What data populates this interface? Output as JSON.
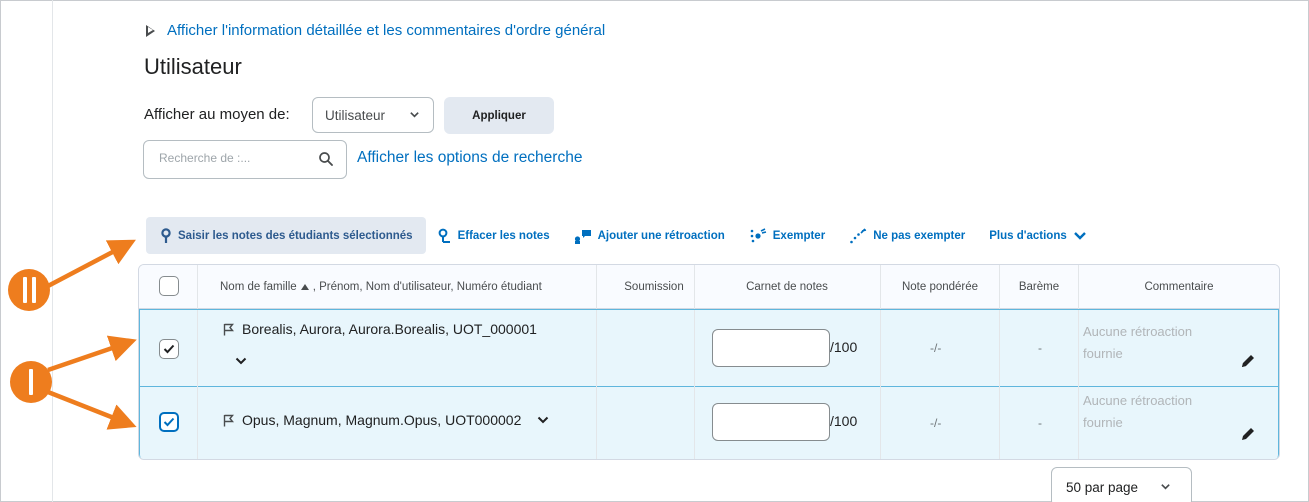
{
  "details_link": "Afficher l'information détaillée et les commentaires d'ordre général",
  "page_title": "Utilisateur",
  "view_by": {
    "label": "Afficher au moyen de:",
    "selected": "Utilisateur",
    "apply_label": "Appliquer"
  },
  "search": {
    "placeholder": "Recherche de :...",
    "options_link": "Afficher les options de recherche"
  },
  "toolbar": {
    "enter_grades": "Saisir les notes des étudiants sélectionnés",
    "clear_grades": "Effacer les notes",
    "add_feedback": "Ajouter une rétroaction",
    "exempt": "Exempter",
    "unexempt": "Ne pas exempter",
    "more_actions": "Plus d'actions"
  },
  "table": {
    "headers": {
      "name": "Nom de famille",
      "name_rest": ", Prénom, Nom d'utilisateur, Numéro étudiant",
      "submission": "Soumission",
      "gradebook": "Carnet de notes",
      "weighted": "Note pondérée",
      "scheme": "Barème",
      "comment": "Commentaire"
    },
    "rows": [
      {
        "name": "Borealis, Aurora, Aurora.Borealis, UOT_000001",
        "checked": true,
        "grade_value": "",
        "grade_out_of": "/100",
        "weighted": "-/-",
        "scheme": "-",
        "feedback_line1": "Aucune rétroaction",
        "feedback_line2": "fournie"
      },
      {
        "name": "Opus, Magnum, Magnum.Opus, UOT000002",
        "checked": true,
        "grade_value": "",
        "grade_out_of": "/100",
        "weighted": "-/-",
        "scheme": "-",
        "feedback_line1": "Aucune rétroaction",
        "feedback_line2": "fournie"
      }
    ]
  },
  "per_page": "50 par page",
  "colors": {
    "link": "#006fbf",
    "selected_row_bg": "#e8f6fc",
    "selected_row_border": "#5fb6dd",
    "annotation_orange": "#ee7d1e"
  }
}
